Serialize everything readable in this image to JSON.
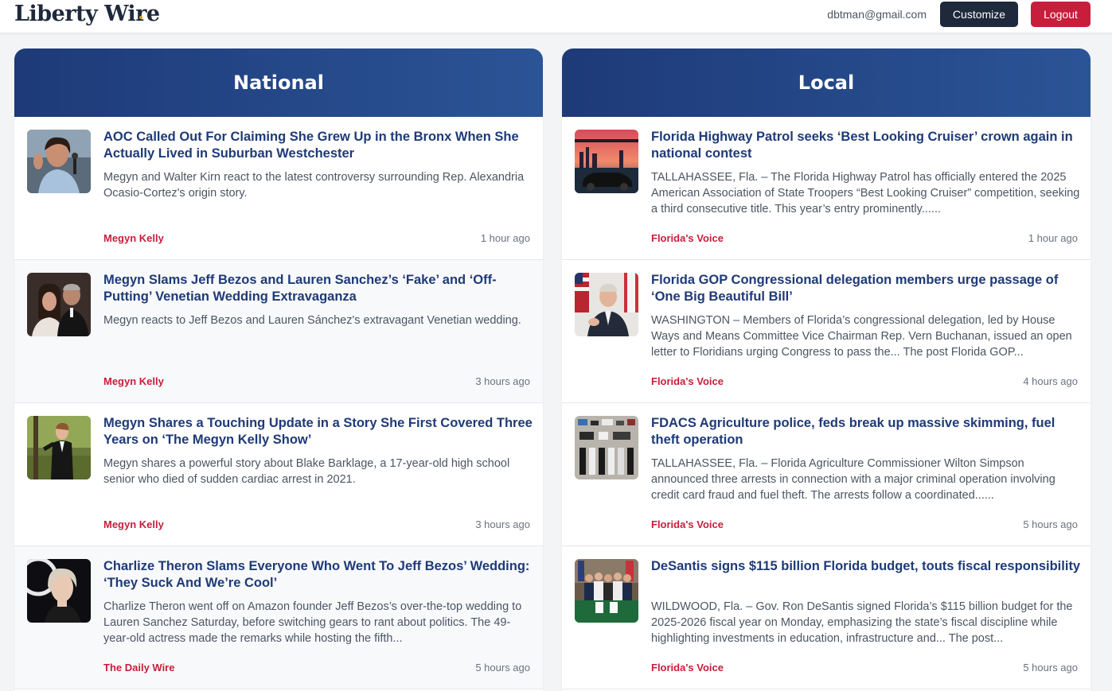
{
  "header": {
    "logo": "Liberty Wire",
    "user_email": "dbtman@gmail.com",
    "customize_label": "Customize",
    "logout_label": "Logout"
  },
  "colors": {
    "brand_navy": "#1e3a78",
    "accent_red": "#c81e3b",
    "dark_button": "#1e293b"
  },
  "national": {
    "title": "National",
    "articles": [
      {
        "headline": "AOC Called Out For Claiming She Grew Up in the Bronx When She Actually Lived in Suburban Westchester",
        "summary": "Megyn and Walter Kirn react to the latest controversy surrounding Rep. Alexandria Ocasio-Cortez's origin story.",
        "source": "Megyn Kelly",
        "time": "1 hour ago",
        "thumb": "woman-speaking-at-microphone-image"
      },
      {
        "headline": "Megyn Slams Jeff Bezos and Lauren Sanchez’s ‘Fake’ and ‘Off-Putting’ Venetian Wedding Extravaganza",
        "summary": "Megyn reacts to Jeff Bezos and Lauren Sánchez's extravagant Venetian wedding.",
        "source": "Megyn Kelly",
        "time": "3 hours ago",
        "thumb": "couple-photo-image"
      },
      {
        "headline": "Megyn Shares a Touching Update in a Story She First Covered Three Years on ‘The Megyn Kelly Show’",
        "summary": "Megyn shares a powerful story about Blake Barklage, a 17-year-old high school senior who died of sudden cardiac arrest in 2021.",
        "source": "Megyn Kelly",
        "time": "3 hours ago",
        "thumb": "teen-in-tuxedo-image"
      },
      {
        "headline": "Charlize Theron Slams Everyone Who Went To Jeff Bezos’ Wedding: ‘They Suck And We’re Cool’",
        "summary": "Charlize Theron went off on Amazon founder Jeff Bezos’s over-the-top wedding to Lauren Sanchez Saturday, before switching gears to rant about politics. The 49-year-old actress made the remarks while hosting the fifth...",
        "source": "The Daily Wire",
        "time": "5 hours ago",
        "thumb": "blonde-woman-portrait-image"
      }
    ]
  },
  "local": {
    "title": "Local",
    "articles": [
      {
        "headline": "Florida Highway Patrol seeks ‘Best Looking Cruiser’ crown again in national contest",
        "summary": "TALLAHASSEE, Fla. – The Florida Highway Patrol has officially entered the 2025 American Association of State Troopers “Best Looking Cruiser” competition, seeking a third consecutive title. This year’s entry prominently......",
        "source": "Florida's Voice",
        "time": "1 hour ago",
        "thumb": "police-cruiser-at-sunset-image"
      },
      {
        "headline": "Florida GOP Congressional delegation members urge passage of ‘One Big Beautiful Bill’",
        "summary": "WASHINGTON – Members of Florida’s congressional delegation, led by House Ways and Means Committee Vice Chairman Rep. Vern Buchanan, issued an open letter to Floridians urging Congress to pass the... The post Florida GOP...",
        "source": "Florida's Voice",
        "time": "4 hours ago",
        "thumb": "congressman-with-flags-image"
      },
      {
        "headline": "FDACS Agriculture police, feds break up massive skimming, fuel theft operation",
        "summary": "TALLAHASSEE, Fla. – Florida Agriculture Commissioner Wilton Simpson announced three arrests in connection with a major criminal operation involving credit card fraud and fuel theft. The arrests follow a coordinated......",
        "source": "Florida's Voice",
        "time": "5 hours ago",
        "thumb": "seized-evidence-table-image"
      },
      {
        "headline": "DeSantis signs $115 billion Florida budget, touts fiscal responsibility",
        "summary": "WILDWOOD, Fla. – Gov. Ron DeSantis signed Florida’s $115 billion budget for the 2025-2026 fiscal year on Monday, emphasizing the state’s fiscal discipline while highlighting investments in education, infrastructure and... The post...",
        "source": "Florida's Voice",
        "time": "5 hours ago",
        "thumb": "budget-signing-ceremony-image"
      }
    ]
  }
}
